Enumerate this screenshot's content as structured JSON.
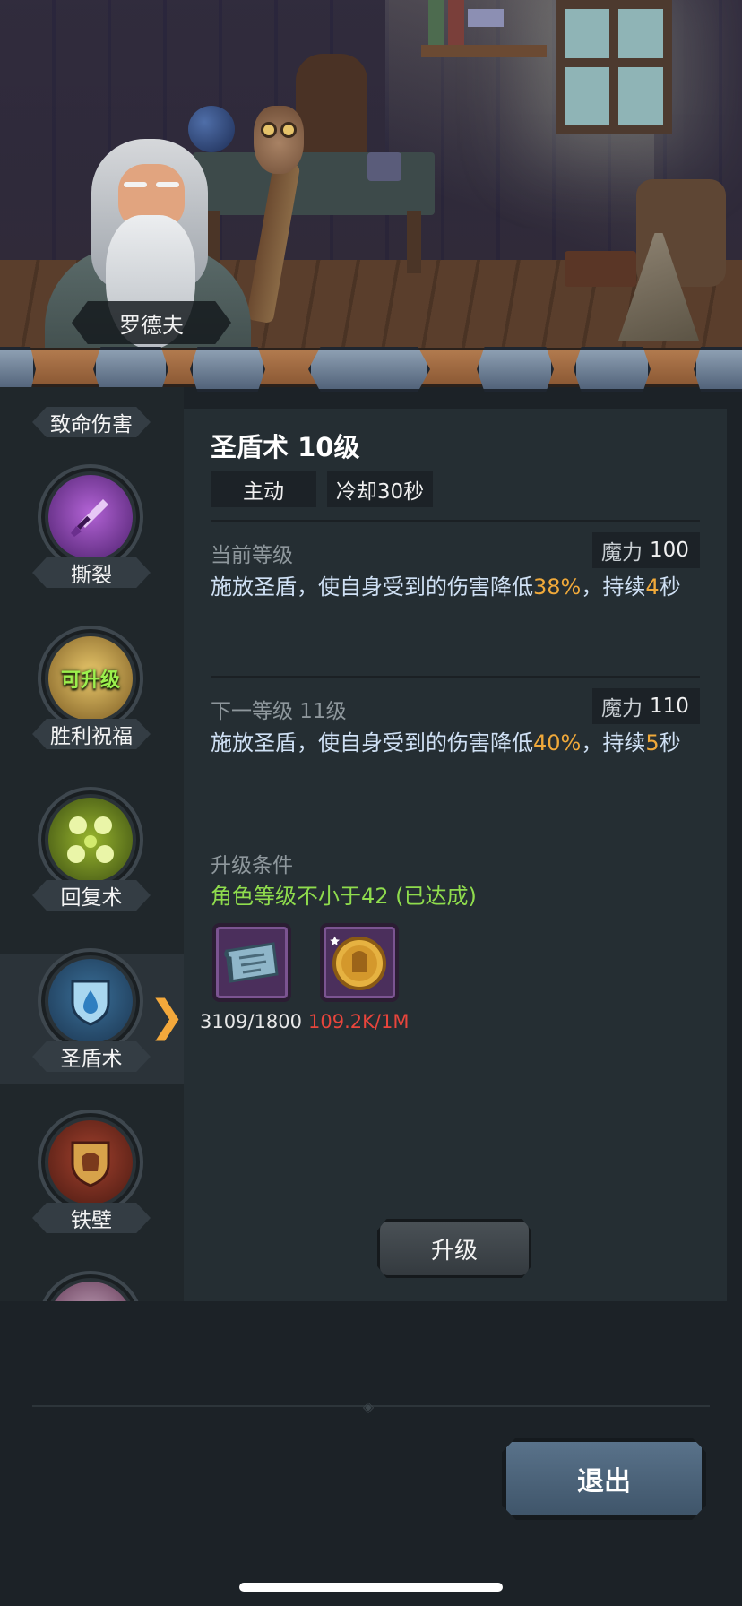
{
  "npc": {
    "name": "罗德夫"
  },
  "skills": [
    {
      "label": "致命伤害",
      "icon": "crit-damage-icon"
    },
    {
      "label": "撕裂",
      "icon": "purple-dagger-icon"
    },
    {
      "label": "胜利祝福",
      "icon": "golden-crown-icon",
      "badge": "可升级"
    },
    {
      "label": "回复术",
      "icon": "green-orbs-icon"
    },
    {
      "label": "圣盾术",
      "icon": "water-shield-icon",
      "selected": true
    },
    {
      "label": "铁壁",
      "icon": "bronze-helm-shield-icon"
    }
  ],
  "detail": {
    "title": "圣盾术 10级",
    "type_tag": "主动",
    "cooldown_tag": "冷却30秒",
    "current": {
      "label": "当前等级",
      "mana_label": "魔力",
      "mana_value": "100",
      "desc_pre": "施放圣盾，使自身受到的伤害降低",
      "desc_pct": "38%",
      "desc_mid": "，持续",
      "desc_dur": "4",
      "desc_post": "秒"
    },
    "next": {
      "label": "下一等级 11级",
      "mana_label": "魔力",
      "mana_value": "110",
      "desc_pre": "施放圣盾，使自身受到的伤害降低",
      "desc_pct": "40%",
      "desc_mid": "，持续",
      "desc_dur": "5",
      "desc_post": "秒"
    },
    "requirements": {
      "label": "升级条件",
      "condition": "角色等级不小于42 (已达成)"
    },
    "materials": [
      {
        "icon": "scroll-icon",
        "count": "3109/1800",
        "color": "#e8e8e8"
      },
      {
        "icon": "gold-coin-icon",
        "count": "109.2K/1M",
        "color": "#e8453c"
      }
    ],
    "upgrade_label": "升级"
  },
  "exit_label": "退出",
  "colors": {
    "highlight": "#f0a93a",
    "met": "#8fdc4d",
    "insufficient": "#e8453c",
    "arrow": "#f3a83b"
  }
}
